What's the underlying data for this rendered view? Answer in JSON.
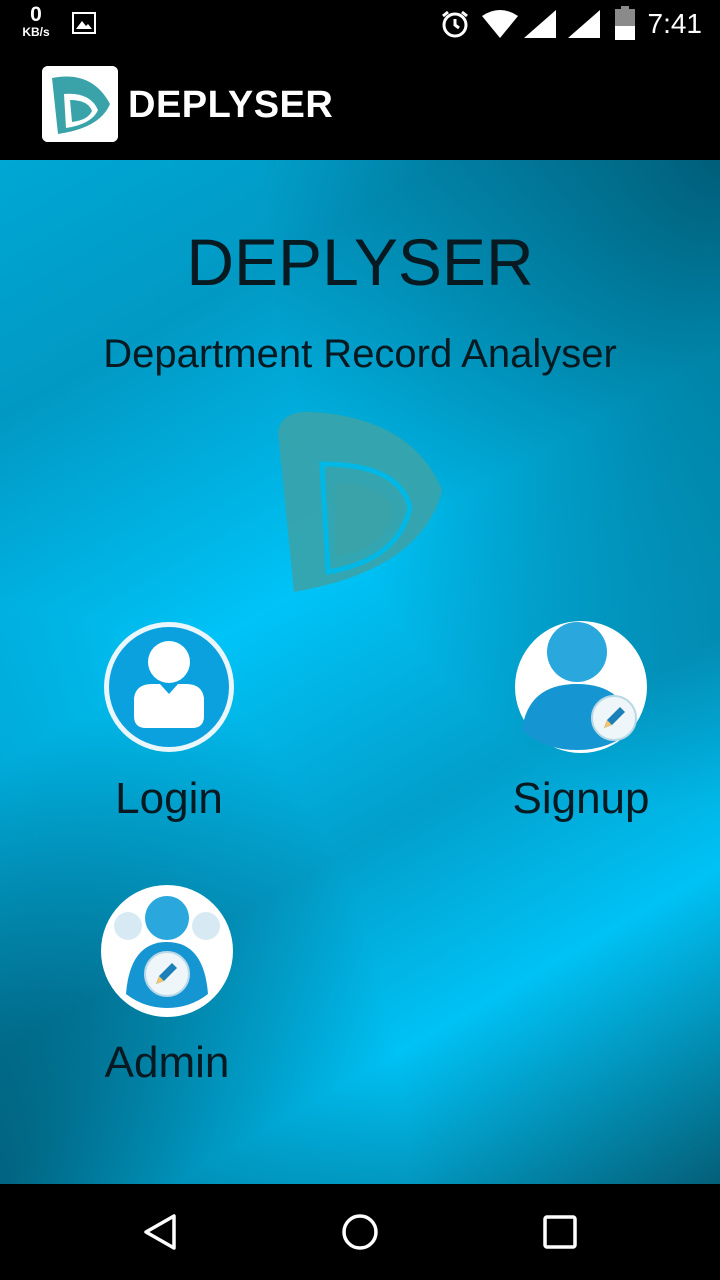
{
  "status_bar": {
    "net_speed_value": "0",
    "net_speed_unit": "KB/s",
    "time": "7:41",
    "icons": [
      "image-icon",
      "alarm-icon",
      "wifi-icon",
      "signal-icon",
      "signal-icon",
      "battery-icon"
    ]
  },
  "app_bar": {
    "title": "DEPLYSER",
    "logo_icon": "deplyser-logo-icon"
  },
  "main": {
    "title": "DEPLYSER",
    "subtitle": "Department Record Analyser",
    "actions": [
      {
        "label": "Login",
        "icon": "user-icon"
      },
      {
        "label": "Signup",
        "icon": "user-edit-icon"
      },
      {
        "label": "Admin",
        "icon": "admin-edit-icon"
      }
    ]
  },
  "nav_bar": {
    "buttons": [
      "back-icon",
      "home-icon",
      "recents-icon"
    ]
  },
  "colors": {
    "bar_background": "#000000",
    "main_gradient_light": "#00c3f7",
    "main_gradient_dark": "#045f78",
    "text_dark": "#071a22",
    "logo_teal": "#3aa3aa"
  }
}
